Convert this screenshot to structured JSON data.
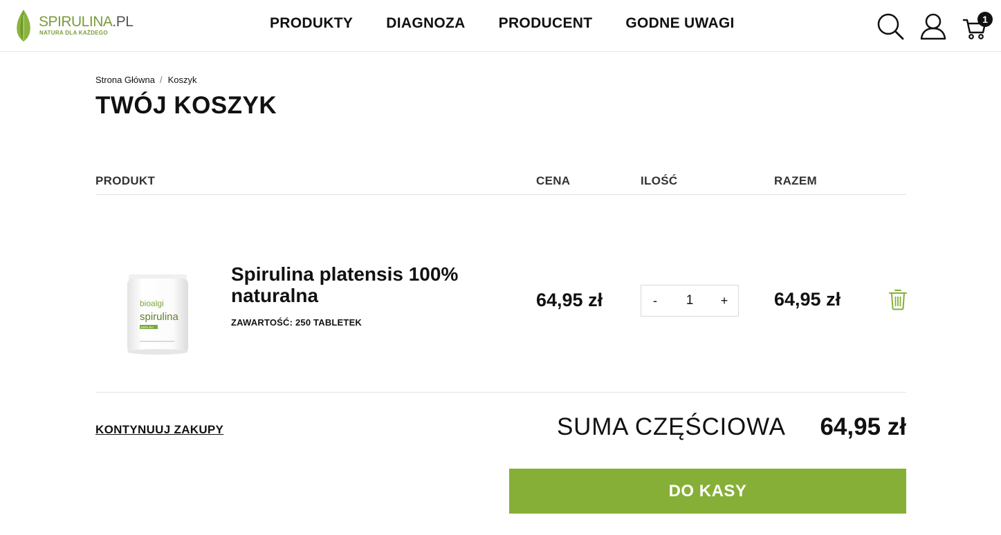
{
  "header": {
    "logo": {
      "brand": "SPIRULINA",
      "suffix": ".PL",
      "tagline": "NATURA DLA KAŻDEGO"
    },
    "nav": [
      "PRODUKTY",
      "DIAGNOZA",
      "PRODUCENT",
      "GODNE UWAGI"
    ],
    "icons": {
      "search": "search-icon",
      "account": "user-icon",
      "cart": "cart-icon"
    },
    "cart_count": "1"
  },
  "breadcrumb": {
    "home": "Strona Główna",
    "separator": "/",
    "current": "Koszyk"
  },
  "page_title": "TWÓJ KOSZYK",
  "table": {
    "columns": {
      "product": "PRODUKT",
      "price": "CENA",
      "quantity": "ILOŚĆ",
      "total": "RAZEM"
    },
    "rows": [
      {
        "name": "Spirulina platensis 100% naturalna",
        "variant": "ZAWARTOŚĆ: 250 TABLETEK",
        "image_text": {
          "brand": "bioalgi",
          "product": "spirulina",
          "badge": "100% bio"
        },
        "price": "64,95 zł",
        "qty_minus": "-",
        "quantity": "1",
        "qty_plus": "+",
        "total": "64,95 zł",
        "remove_icon": "trash-icon"
      }
    ]
  },
  "footer": {
    "continue_label": "KONTYNUUJ ZAKUPY",
    "subtotal_label": "SUMA CZĘŚCIOWA",
    "subtotal_value": "64,95 zł",
    "checkout_label": "DO KASY"
  },
  "colors": {
    "accent": "#86af37",
    "logo_green": "#7a9c3a",
    "text": "#111111"
  }
}
